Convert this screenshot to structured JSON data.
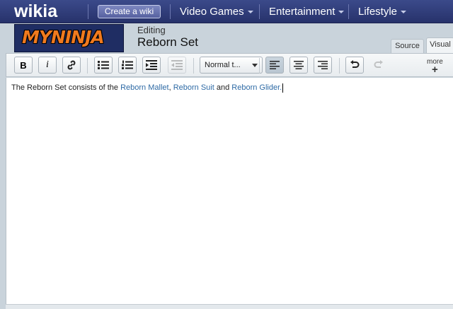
{
  "topnav": {
    "logo": "wikia",
    "create_label": "Create a wiki",
    "links": [
      {
        "label": "Video Games"
      },
      {
        "label": "Entertainment"
      },
      {
        "label": "Lifestyle"
      }
    ]
  },
  "header": {
    "wiki_logo": "MYNINJA",
    "editing_label": "Editing",
    "page_title": "Reborn Set"
  },
  "tabs": {
    "source": "Source",
    "visual": "Visual"
  },
  "toolbar": {
    "bold": "B",
    "italic": "i",
    "format_select": "Normal t...",
    "more": "more",
    "more_plus": "+"
  },
  "content": {
    "text_before": "The Reborn Set consists of the ",
    "link1": "Reborn Mallet",
    "sep1": ", ",
    "link2": "Reborn Suit",
    "mid": " and ",
    "link3": "Reborn Glider",
    "end": "."
  },
  "colors": {
    "nav_bg": "#2f3b7a",
    "link": "#2e6aa5",
    "logo_orange": "#f07a1e"
  }
}
